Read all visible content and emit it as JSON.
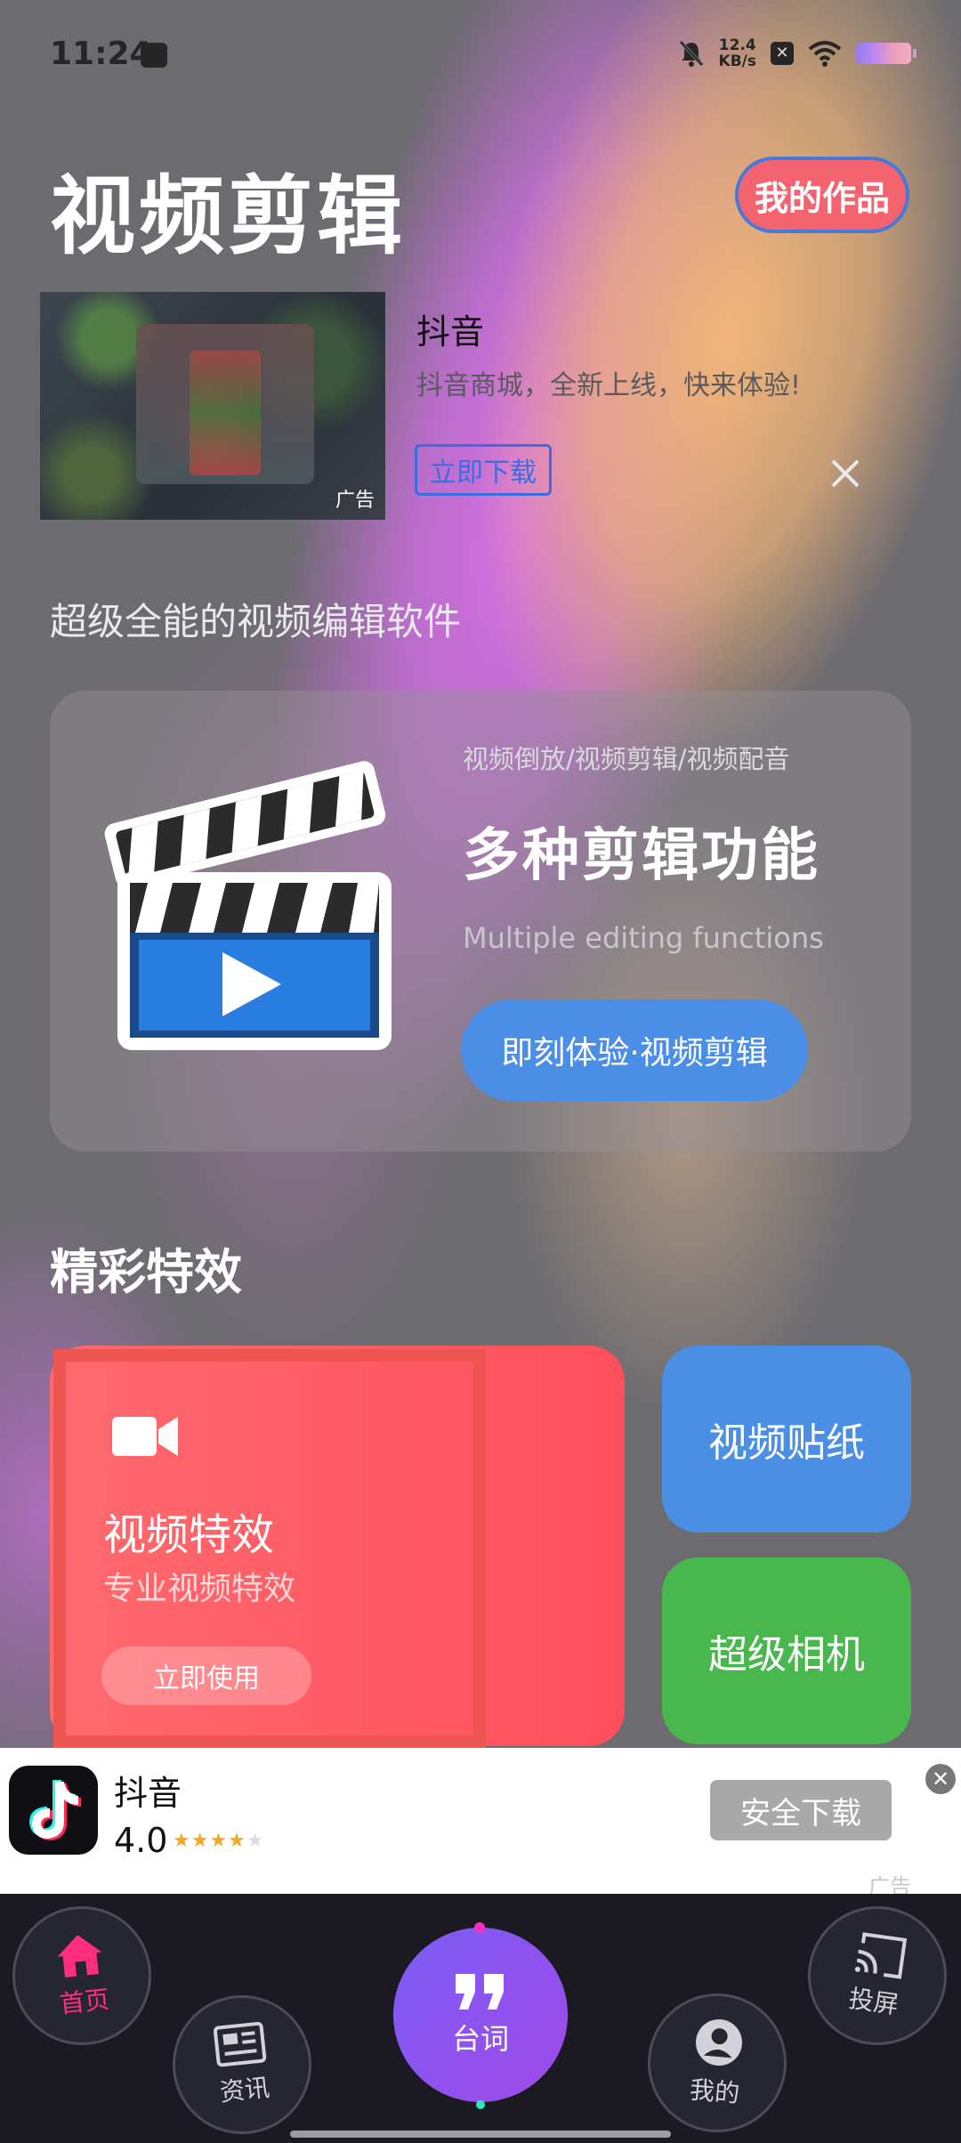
{
  "status_bar": {
    "time": "11:24",
    "net_speed_value": "12.4",
    "net_speed_unit": "KB/s"
  },
  "header": {
    "title": "视频剪辑",
    "my_works_label": "我的作品"
  },
  "top_ad": {
    "title": "抖音",
    "description": "抖音商城，全新上线，快来体验!",
    "download_label": "立即下载",
    "ad_label": "广告"
  },
  "subtitle": "超级全能的视频编辑软件",
  "feature_card": {
    "tags": "视频倒放/视频剪辑/视频配音",
    "title": "多种剪辑功能",
    "subtitle_en": "Multiple editing functions",
    "cta_label": "即刻体验·视频剪辑"
  },
  "section_title": "精彩特效",
  "effects": {
    "main": {
      "title": "视频特效",
      "subtitle": "专业视频特效",
      "button_label": "立即使用"
    },
    "sticker_label": "视频贴纸",
    "camera_label": "超级相机"
  },
  "banner_ad": {
    "app_name": "抖音",
    "rating": "4.0",
    "rating_stars": 4,
    "download_label": "安全下载",
    "ad_label": "广告"
  },
  "nav": {
    "home": "首页",
    "news": "资讯",
    "lines": "台词",
    "mine": "我的",
    "cast": "投屏"
  },
  "colors": {
    "accent_red": "#ff5460",
    "accent_blue": "#4a8fe3",
    "accent_green": "#48b84e",
    "nav_active": "#ff2e7d",
    "nav_center": "#8b54ee"
  }
}
